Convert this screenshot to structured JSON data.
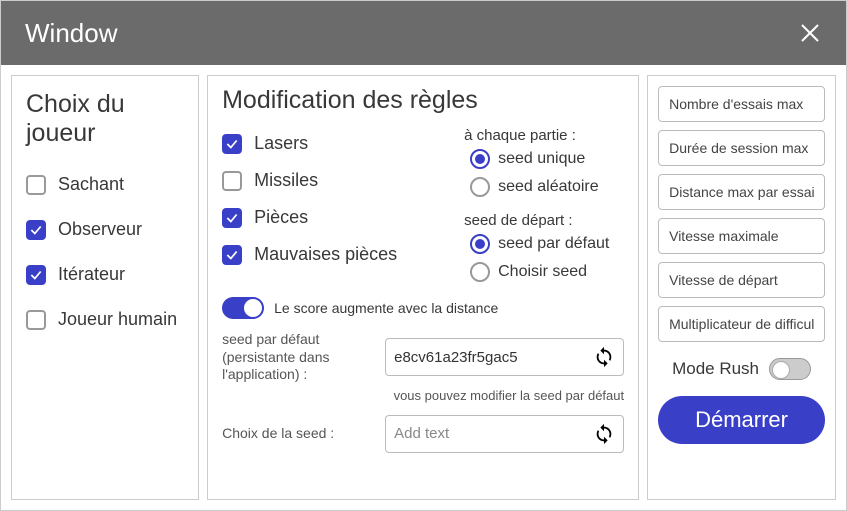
{
  "window": {
    "title": "Window"
  },
  "players": {
    "heading": "Choix du joueur",
    "items": [
      {
        "label": "Sachant",
        "checked": false
      },
      {
        "label": "Observeur",
        "checked": true
      },
      {
        "label": "Itérateur",
        "checked": true
      },
      {
        "label": "Joueur humain",
        "checked": false
      }
    ]
  },
  "rules": {
    "heading": "Modification des règles",
    "items": [
      {
        "label": "Lasers",
        "checked": true
      },
      {
        "label": "Missiles",
        "checked": false
      },
      {
        "label": "Pièces",
        "checked": true
      },
      {
        "label": "Mauvaises pièces",
        "checked": true
      }
    ],
    "seed_mode": {
      "heading": "à chaque partie :",
      "options": [
        {
          "label": "seed unique",
          "checked": true
        },
        {
          "label": "seed aléatoire",
          "checked": false
        }
      ]
    },
    "start_seed": {
      "heading": "seed de départ :",
      "options": [
        {
          "label": "seed par défaut",
          "checked": true
        },
        {
          "label": "Choisir seed",
          "checked": false
        }
      ]
    },
    "score_toggle": {
      "label": "Le score augmente avec la distance",
      "on": true
    },
    "default_seed": {
      "label": "seed par défaut (persistante dans l'application) :",
      "value": "e8cv61a23fr5gac5"
    },
    "note": "vous pouvez modifier la seed par défaut",
    "choose_seed": {
      "label": "Choix de la seed :",
      "placeholder": "Add text"
    }
  },
  "params": {
    "placeholders": [
      "Nombre d'essais max",
      "Durée de session max",
      "Distance max par essai",
      "Vitesse maximale",
      "Vitesse de départ",
      "Multiplicateur de difficulté"
    ],
    "mode_rush": {
      "label": "Mode Rush",
      "on": false
    },
    "start_button": "Démarrer"
  }
}
